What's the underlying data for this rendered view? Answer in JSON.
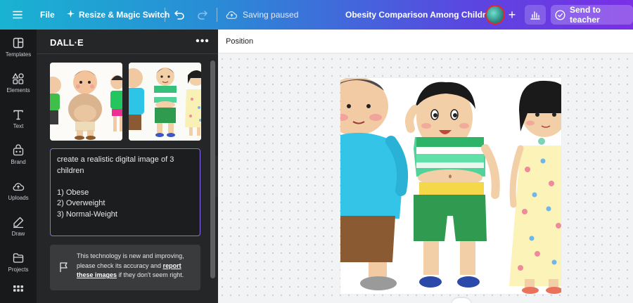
{
  "topbar": {
    "file_label": "File",
    "resize_label": "Resize & Magic Switch",
    "saving_status": "Saving paused",
    "document_title": "Obesity Comparison Among Children",
    "add_label": "+",
    "send_label": "Send to teacher"
  },
  "rail": {
    "items": [
      {
        "label": "Templates",
        "icon": "templates-icon"
      },
      {
        "label": "Elements",
        "icon": "elements-icon"
      },
      {
        "label": "Text",
        "icon": "text-icon"
      },
      {
        "label": "Brand",
        "icon": "brand-icon"
      },
      {
        "label": "Uploads",
        "icon": "uploads-icon"
      },
      {
        "label": "Draw",
        "icon": "draw-icon"
      },
      {
        "label": "Projects",
        "icon": "projects-icon"
      },
      {
        "label": "",
        "icon": "apps-icon"
      }
    ]
  },
  "panel": {
    "title": "DALL·E",
    "more": "•••",
    "prompt": "create a realistic digital image of 3 children\n\n1) Obese\n2) Overweight\n3) Normal-Weight",
    "notice_before": "This technology is new and improving, please check its accuracy and ",
    "notice_link": "report these images",
    "notice_after": " if they don't seem right."
  },
  "canvas": {
    "position_label": "Position"
  },
  "colors": {
    "accent_purple": "#8b6cf0",
    "topbar_start": "#19b3d2",
    "topbar_end": "#7a2fe6"
  }
}
